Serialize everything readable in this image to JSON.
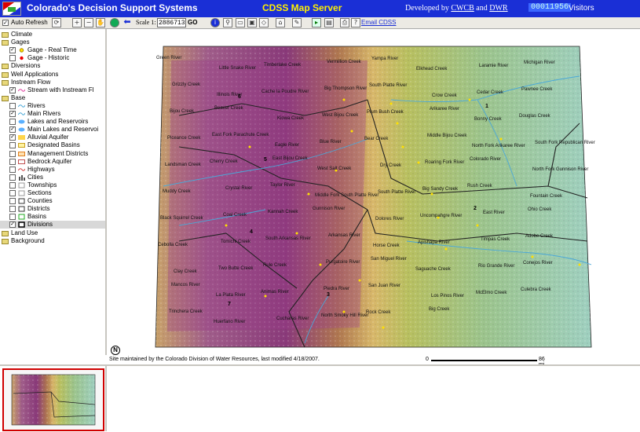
{
  "header": {
    "app_title": "Colorado's Decision Support Systems",
    "server_title": "CDSS Map Server",
    "developed_by": "Developed by",
    "cwcb": "CWCB",
    "and": "and",
    "dwr": "DWR",
    "visitor_count": "00011956",
    "visitors_label": "Visitors"
  },
  "toolbar": {
    "auto_refresh_label": "Auto Refresh",
    "scale_label": "Scale 1:",
    "scale_value": "2886713",
    "go_label": "GO",
    "email_label": "Email CDSS"
  },
  "layers": [
    {
      "label": "Climate",
      "type": "folder",
      "indent": 0
    },
    {
      "label": "Gages",
      "type": "folder",
      "indent": 0
    },
    {
      "label": "Gage - Real Time",
      "type": "layer",
      "indent": 2,
      "checked": true,
      "symbol": "dot-yellow"
    },
    {
      "label": "Gage - Historic",
      "type": "layer",
      "indent": 2,
      "checked": false,
      "symbol": "dot-red"
    },
    {
      "label": "Diversions",
      "type": "folder",
      "indent": 0
    },
    {
      "label": "Well Applications",
      "type": "folder",
      "indent": 0
    },
    {
      "label": "Instream Flow",
      "type": "folder",
      "indent": 0
    },
    {
      "label": "Stream with Instream Fl",
      "type": "layer",
      "indent": 2,
      "checked": true,
      "symbol": "line-pink"
    },
    {
      "label": "Base",
      "type": "folder",
      "indent": 0
    },
    {
      "label": "Rivers",
      "type": "layer",
      "indent": 2,
      "checked": false,
      "symbol": "line-blue"
    },
    {
      "label": "Main Rivers",
      "type": "layer",
      "indent": 2,
      "checked": true,
      "symbol": "line-blue"
    },
    {
      "label": "Lakes and Reservoirs",
      "type": "layer",
      "indent": 2,
      "checked": false,
      "symbol": "lake"
    },
    {
      "label": "Main Lakes and Reservoi",
      "type": "layer",
      "indent": 2,
      "checked": true,
      "symbol": "lake"
    },
    {
      "label": "Alluvial Aquifer",
      "type": "layer",
      "indent": 2,
      "checked": true,
      "symbol": "aquifer"
    },
    {
      "label": "Designated Basins",
      "type": "layer",
      "indent": 2,
      "checked": false,
      "symbol": "basin-yellow"
    },
    {
      "label": "Management Districts",
      "type": "layer",
      "indent": 2,
      "checked": false,
      "symbol": "basin-orange"
    },
    {
      "label": "Bedrock Aquifer",
      "type": "layer",
      "indent": 2,
      "checked": false,
      "symbol": "bedrock"
    },
    {
      "label": "Highways",
      "type": "layer",
      "indent": 2,
      "checked": false,
      "symbol": "line-red"
    },
    {
      "label": "Cities",
      "type": "layer",
      "indent": 2,
      "checked": false,
      "symbol": "city"
    },
    {
      "label": "Townships",
      "type": "layer",
      "indent": 2,
      "checked": false,
      "symbol": "box-gray"
    },
    {
      "label": "Sections",
      "type": "layer",
      "indent": 2,
      "checked": false,
      "symbol": "box-gray"
    },
    {
      "label": "Counties",
      "type": "layer",
      "indent": 2,
      "checked": false,
      "symbol": "box-black"
    },
    {
      "label": "Districts",
      "type": "layer",
      "indent": 2,
      "checked": false,
      "symbol": "box-black"
    },
    {
      "label": "Basins",
      "type": "layer",
      "indent": 2,
      "checked": false,
      "symbol": "box-green"
    },
    {
      "label": "Divisions",
      "type": "layer",
      "indent": 2,
      "checked": true,
      "symbol": "box-black-thick",
      "selected": true
    },
    {
      "label": "Land Use",
      "type": "folder",
      "indent": 0
    },
    {
      "label": "Background",
      "type": "folder",
      "indent": 0
    }
  ],
  "map": {
    "labels": [
      "Green River",
      "Little Snake River",
      "Timberlake Creek",
      "Vermillion Creek",
      "Yampa River",
      "Elkhead Creek",
      "Laramie River",
      "Michigan River",
      "Grizzly Creek",
      "Illinois River",
      "Cache la Poudre River",
      "Big Thompson River",
      "South Platte River",
      "Crow Creek",
      "Cedar Creek",
      "Pawnee Creek",
      "Bijou Creek",
      "Beaver Creek",
      "Kiowa Creek",
      "West Bijou Creek",
      "Plum Bush Creek",
      "Arikaree River",
      "Bonny Creek",
      "Douglas Creek",
      "Piceance Creek",
      "East Fork Parachute Creek",
      "Eagle River",
      "Blue River",
      "Bear Creek",
      "Middle Bijou Creek",
      "North Fork Arikaree River",
      "South Fork Republican River",
      "Landsman Creek",
      "Cherry Creek",
      "East Bijou Creek",
      "West Salt Creek",
      "Dry Creek",
      "Roaring Fork River",
      "Colorado River",
      "North Fork Gunnison River",
      "Muddy Creek",
      "Crystal River",
      "Taylor River",
      "Middle Fork South Platte River",
      "South Platte River",
      "Big Sandy Creek",
      "Rush Creek",
      "Fountain Creek",
      "Black Squirrel Creek",
      "Coal Creek",
      "Kannah Creek",
      "Gunnison River",
      "Dolores River",
      "Uncompahgre River",
      "East River",
      "Ohio Creek",
      "Cebolla Creek",
      "Tomichi Creek",
      "South Arkansas River",
      "Arkansas River",
      "Horse Creek",
      "Apishapa River",
      "Timpas Creek",
      "Adobe Creek",
      "Clay Creek",
      "Two Butte Creek",
      "Rule Creek",
      "Purgatoire River",
      "San Miguel River",
      "Saguache Creek",
      "Rio Grande River",
      "Conejos River",
      "Mancos River",
      "La Plata River",
      "Animas River",
      "Piedra River",
      "San Juan River",
      "Los Pinos River",
      "McElmo Creek",
      "Culebra Creek",
      "Trinchera Creek",
      "Huerfano River",
      "Cucharas River",
      "North Smoky Hill River",
      "Rock Creek",
      "Big Creek"
    ],
    "division_numbers": [
      "1",
      "2",
      "3",
      "4",
      "5",
      "6",
      "7"
    ]
  },
  "footer": {
    "maintained_text": "Site maintained by the Colorado Division of Water Resources, last modified 4/18/2007.",
    "scale_zero": "0",
    "scale_max": "86 mi",
    "north_symbol": "N"
  }
}
